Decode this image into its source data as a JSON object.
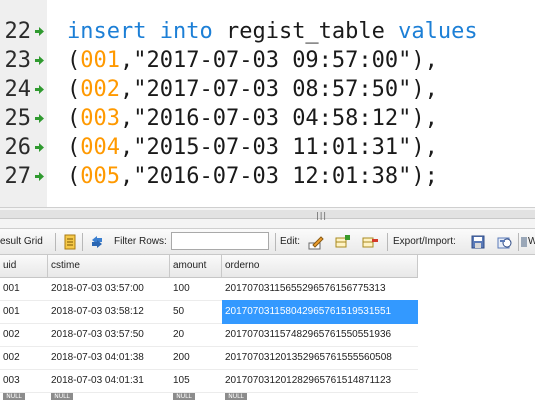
{
  "editor": {
    "lines": [
      {
        "num": "22",
        "parts": [
          {
            "t": "insert",
            "c": "kw"
          },
          {
            "t": " ",
            "c": "pun"
          },
          {
            "t": "into",
            "c": "kw"
          },
          {
            "t": " regist_table ",
            "c": "pun"
          },
          {
            "t": "values",
            "c": "kw"
          }
        ]
      },
      {
        "num": "23",
        "parts": [
          {
            "t": "(",
            "c": "pun"
          },
          {
            "t": "001",
            "c": "num"
          },
          {
            "t": ",",
            "c": "pun"
          },
          {
            "t": "\"2017-07-03 09:57:00\"",
            "c": "str"
          },
          {
            "t": "),",
            "c": "pun"
          }
        ]
      },
      {
        "num": "24",
        "parts": [
          {
            "t": "(",
            "c": "pun"
          },
          {
            "t": "002",
            "c": "num"
          },
          {
            "t": ",",
            "c": "pun"
          },
          {
            "t": "\"2017-07-03 08:57:50\"",
            "c": "str"
          },
          {
            "t": "),",
            "c": "pun"
          }
        ]
      },
      {
        "num": "25",
        "parts": [
          {
            "t": "(",
            "c": "pun"
          },
          {
            "t": "003",
            "c": "num"
          },
          {
            "t": ",",
            "c": "pun"
          },
          {
            "t": "\"2016-07-03 04:58:12\"",
            "c": "str"
          },
          {
            "t": "),",
            "c": "pun"
          }
        ]
      },
      {
        "num": "26",
        "parts": [
          {
            "t": "(",
            "c": "pun"
          },
          {
            "t": "004",
            "c": "num"
          },
          {
            "t": ",",
            "c": "pun"
          },
          {
            "t": "\"2015-07-03 11:01:31\"",
            "c": "str"
          },
          {
            "t": "),",
            "c": "pun"
          }
        ]
      },
      {
        "num": "27",
        "parts": [
          {
            "t": "(",
            "c": "pun"
          },
          {
            "t": "005",
            "c": "num"
          },
          {
            "t": ",",
            "c": "pun"
          },
          {
            "t": "\"2016-07-03 12:01:38\"",
            "c": "str"
          },
          {
            "t": ");",
            "c": "pun"
          }
        ]
      }
    ]
  },
  "toolbar": {
    "result_grid_label": "esult Grid",
    "filter_label": "Filter Rows:",
    "filter_value": "",
    "edit_label": "Edit:",
    "export_label": "Export/Import:",
    "wrap_label": "W"
  },
  "grid": {
    "columns": [
      "uid",
      "cstime",
      "amount",
      "orderno"
    ],
    "rows": [
      [
        "001",
        "2018-07-03 03:57:00",
        "100",
        "20170703115655296576156775313"
      ],
      [
        "001",
        "2018-07-03 03:58:12",
        "50",
        "201707031158042965761519531551"
      ],
      [
        "002",
        "2018-07-03 03:57:50",
        "20",
        "201707031157482965761550551936"
      ],
      [
        "002",
        "2018-07-03 04:01:38",
        "200",
        "201707031201352965761555560508"
      ],
      [
        "003",
        "2018-07-03 04:01:31",
        "105",
        "201707031201282965761514871123"
      ]
    ],
    "selected": {
      "row": 1,
      "col": 3
    },
    "null_label": "NULL"
  },
  "colors": {
    "keyword": "#1c7fd6",
    "number": "#ff9900",
    "selection": "#3399ff"
  }
}
